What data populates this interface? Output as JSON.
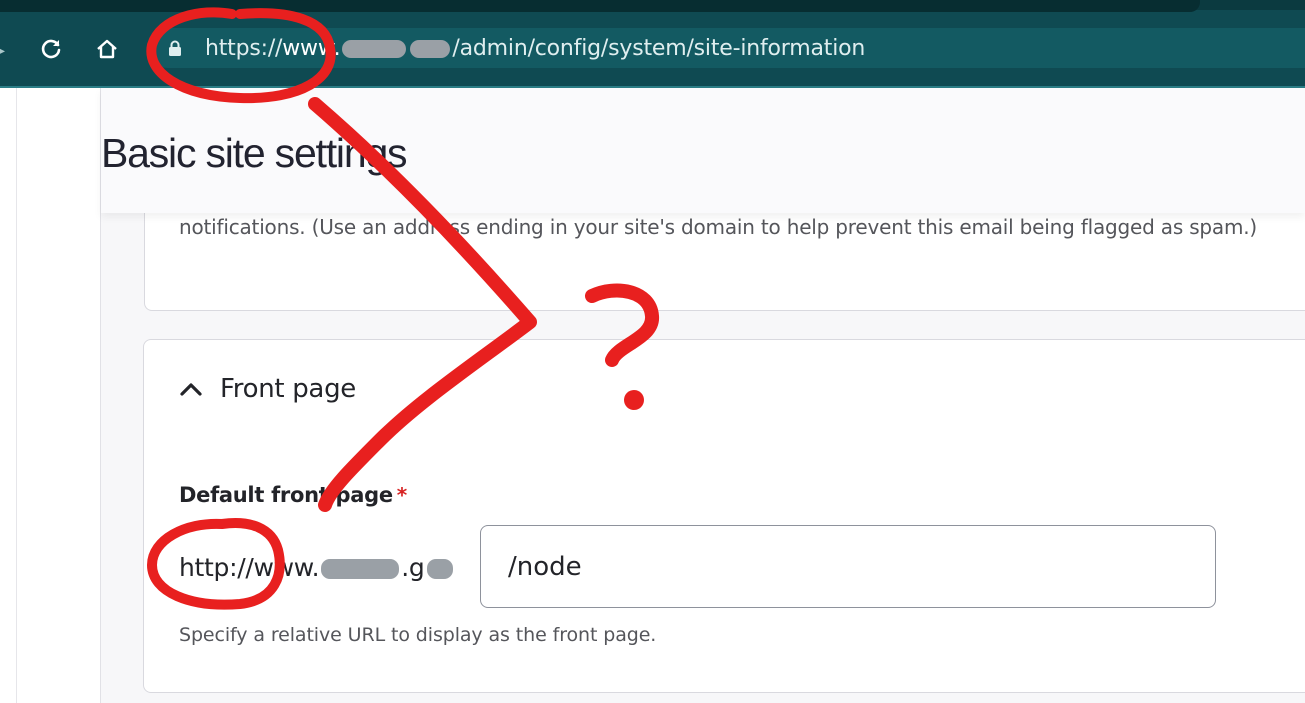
{
  "browser": {
    "url_prefix": "https://",
    "url_host": "www.",
    "url_path": "/admin/config/system/site-information"
  },
  "page": {
    "title": "Basic site settings"
  },
  "email_section": {
    "description": "notifications. (Use an address ending in your site's domain to help prevent this email being flagged as spam.)"
  },
  "front_page": {
    "summary": "Front page",
    "label": "Default front page",
    "required_mark": "*",
    "prefix_start": "http://www.",
    "prefix_end": ".g",
    "value": "/node",
    "help": "Specify a relative URL to display as the front page."
  },
  "annotation": {
    "glyph": "?",
    "color": "#e8201f"
  },
  "icons": [
    "forward-arrow-icon",
    "reload-icon",
    "home-icon",
    "lock-icon",
    "chevron-up-icon"
  ]
}
